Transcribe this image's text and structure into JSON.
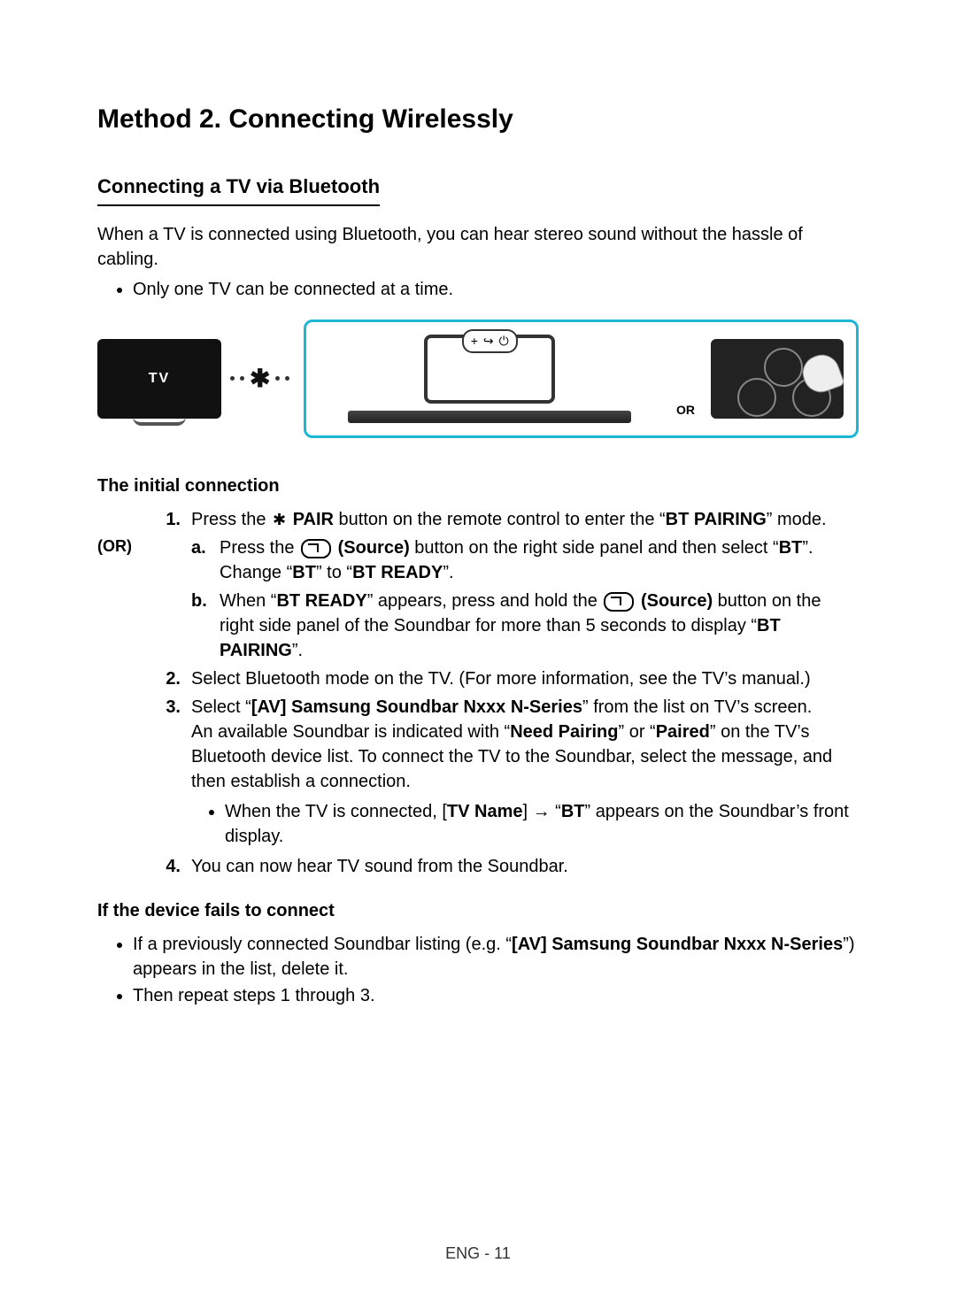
{
  "header": {
    "title": "Method 2. Connecting Wirelessly",
    "subTitle": "Connecting a TV via Bluetooth",
    "intro": "When a TV is connected using Bluetooth, you can hear stereo sound without the hassle of cabling.",
    "bullet1": "Only one TV can be connected at a time."
  },
  "figure": {
    "tvLabel": "TV",
    "orLabel": "OR"
  },
  "initial": {
    "heading": "The initial connection",
    "orLabel": "(OR)",
    "step1_num": "1.",
    "step1_a": "Press the ",
    "step1_pair": " PAIR",
    "step1_b": " button on the remote control to enter the “",
    "step1_bp": "BT PAIRING",
    "step1_c": "” mode.",
    "stepA_marker": "a.",
    "stepA_a": "Press the ",
    "stepA_src": " (Source)",
    "stepA_b": " button on the right side panel and then select “",
    "stepA_bt": "BT",
    "stepA_c": "”.",
    "stepA_line2a": "Change “",
    "stepA_line2b": "BT",
    "stepA_line2c": "” to “",
    "stepA_line2d": "BT READY",
    "stepA_line2e": "”.",
    "stepB_marker": "b.",
    "stepB_a": "When “",
    "stepB_btr": "BT READY",
    "stepB_b": "” appears, press and hold the ",
    "stepB_src": " (Source)",
    "stepB_c": " button on the right side panel of the Soundbar for more than 5 seconds to display “",
    "stepB_bp": "BT PAIRING",
    "stepB_d": "”.",
    "step2_num": "2.",
    "step2": "Select Bluetooth mode on the TV. (For more information, see the TV’s manual.)",
    "step3_num": "3.",
    "step3_a": "Select “",
    "step3_av": "[AV] Samsung Soundbar Nxxx N-Series",
    "step3_b": "” from the list on TV’s screen.",
    "step3_line2a": "An available Soundbar is indicated with “",
    "step3_line2b": "Need Pairing",
    "step3_line2c": "” or “",
    "step3_line2d": "Paired",
    "step3_line2e": "” on the TV’s Bluetooth device list. To connect the TV to the Soundbar, select the message, and then establish a connection.",
    "step3_bullet_a": "When the TV is connected, [",
    "step3_bullet_b": "TV Name",
    "step3_bullet_c": "] → “",
    "step3_bullet_d": "BT",
    "step3_bullet_e": "” appears on the Soundbar’s front display.",
    "step4_num": "4.",
    "step4": "You can now hear TV sound from the Soundbar."
  },
  "fail": {
    "heading": "If the device fails to connect",
    "b1_a": "If a previously connected Soundbar listing (e.g. “",
    "b1_b": "[AV] Samsung Soundbar Nxxx N-Series",
    "b1_c": "”) appears in the list, delete it.",
    "b2": "Then repeat steps 1 through 3."
  },
  "footer": {
    "page": "ENG - 11"
  }
}
